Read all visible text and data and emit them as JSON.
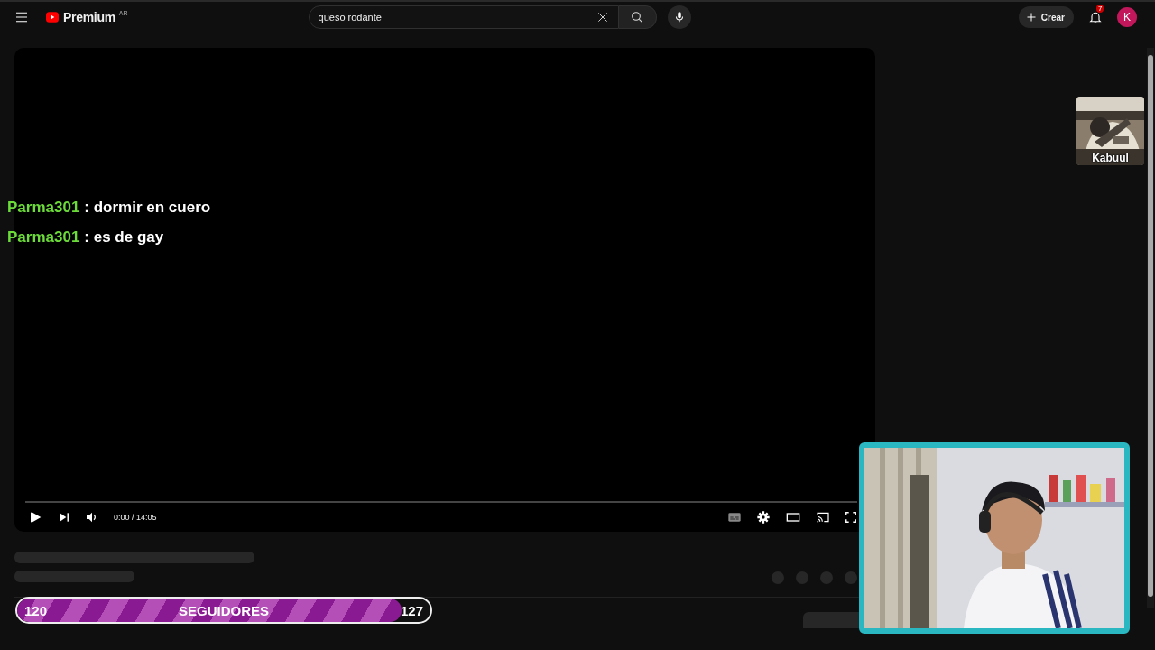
{
  "topbar": {
    "logo": "Premium",
    "region": "AR",
    "search": {
      "value": "queso rodante"
    },
    "create": "Crear",
    "notifications": "7",
    "avatar": "K"
  },
  "player": {
    "chat_messages": [
      {
        "user": "Parma301",
        "text": ": dormir en cuero"
      },
      {
        "user": "Parma301",
        "text": ": es de gay"
      }
    ],
    "time": "0:00 / 14:05"
  },
  "thumbnail_overlay": {
    "kind": "picture",
    "label": "Kabuul"
  },
  "follower_goal": {
    "start": "120",
    "label": "SEGUIDORES",
    "end": "127",
    "level": 0.93
  }
}
